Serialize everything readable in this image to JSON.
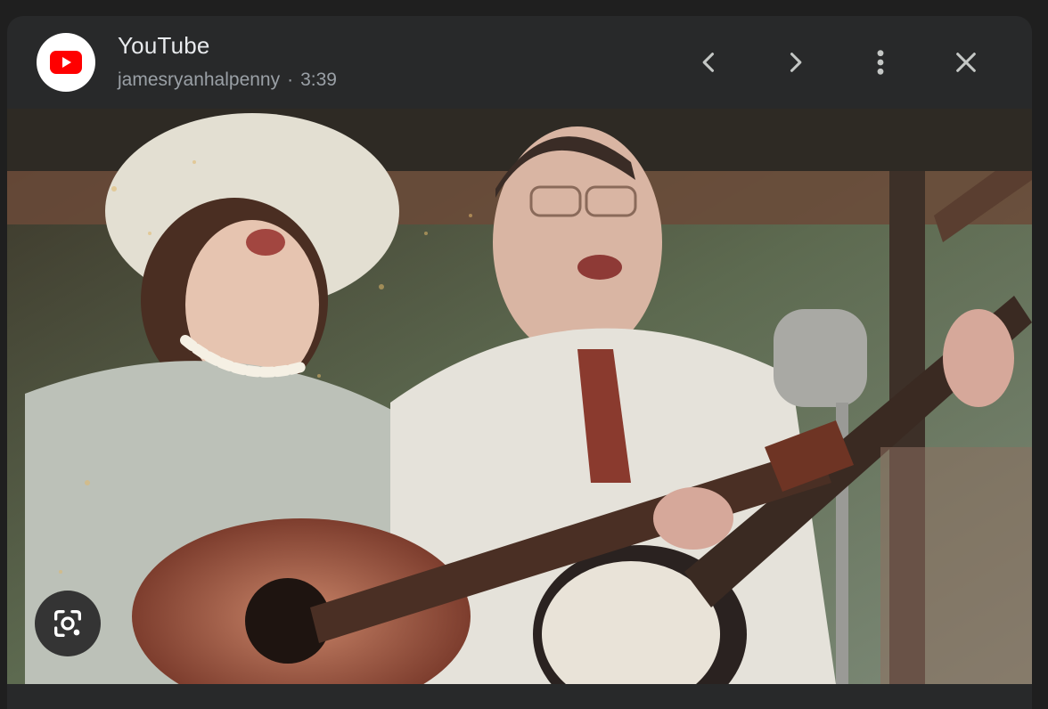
{
  "header": {
    "title": "YouTube",
    "channel": "jamesryanhalpenny",
    "separator": "·",
    "duration": "3:39"
  },
  "icons": {
    "favicon": "youtube-logo-icon",
    "prev": "chevron-left-icon",
    "next": "chevron-right-icon",
    "more": "more-vertical-icon",
    "close": "close-icon",
    "lens": "google-lens-icon"
  },
  "colors": {
    "panel_bg": "#28292a",
    "page_bg": "#1f1f1f",
    "title_text": "#e8eaed",
    "subtitle_text": "#9aa0a6",
    "youtube_red": "#ff0000"
  }
}
